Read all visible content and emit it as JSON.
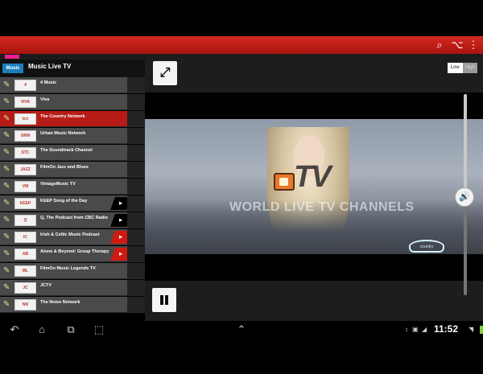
{
  "top_bar": {
    "search_icon": "search-icon",
    "share_icon": "share-icon",
    "menu_icon": "more-vert-icon",
    "accent": "#c41d16"
  },
  "category": {
    "logo_text": "Music",
    "title": "Music Live TV"
  },
  "channels": [
    {
      "name": "4 Music",
      "logo": "4",
      "badge": ""
    },
    {
      "name": "Viva",
      "logo": "VIVA",
      "badge": ""
    },
    {
      "name": "The Country Network",
      "logo": "tcn",
      "badge": "",
      "active": true
    },
    {
      "name": "Urban Music Network",
      "logo": "UMN",
      "badge": ""
    },
    {
      "name": "The Soundtrack Channel",
      "logo": "STC",
      "badge": ""
    },
    {
      "name": "FilmOn Jazz and Blues",
      "logo": "JAZZ",
      "badge": ""
    },
    {
      "name": "VintageMusic TV",
      "logo": "VM",
      "badge": ""
    },
    {
      "name": "KEEP Song of the Day",
      "logo": "KEEP",
      "badge": "black"
    },
    {
      "name": "Q, The Podcast from CBC Radio",
      "logo": "Q",
      "badge": "black"
    },
    {
      "name": "Irish & Celtic Music Podcast",
      "logo": "IC",
      "badge": "red"
    },
    {
      "name": "Alone & Beyond: Group Therapy",
      "logo": "AB",
      "badge": "red"
    },
    {
      "name": "FilmOn Music Legends TV",
      "logo": "ML",
      "badge": ""
    },
    {
      "name": "JCTV",
      "logo": "JC",
      "badge": ""
    },
    {
      "name": "The Noise Network",
      "logo": "NN",
      "badge": ""
    }
  ],
  "player": {
    "quality_low": "Low",
    "quality_high": "High",
    "watermark_brand": "TV",
    "watermark_text": "WORLD LIVE TV CHANNELS",
    "corner_logo": "country",
    "volume_level": 0.51
  },
  "system_bar": {
    "clock": "11:52"
  }
}
